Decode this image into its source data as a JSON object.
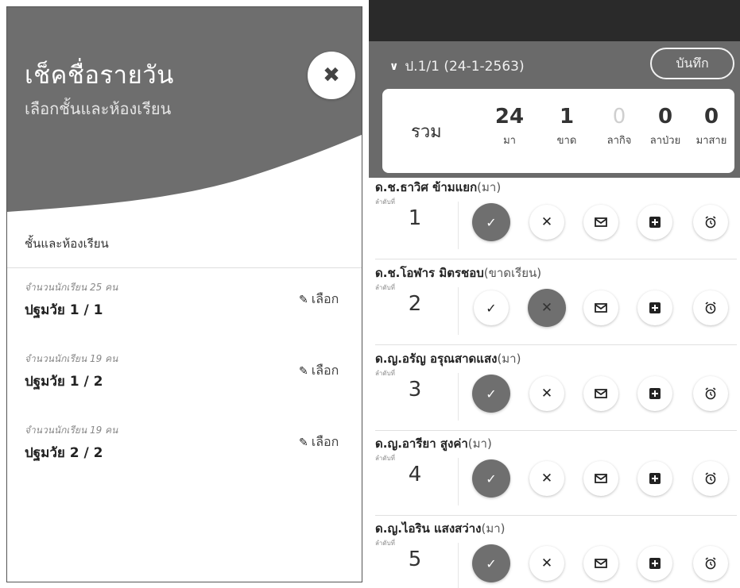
{
  "left_panel": {
    "title": "เช็คชื่อรายวัน",
    "subtitle": "เลือกชั้นและห้องเรียน",
    "close_icon": "✖",
    "section_label": "ชั้นและห้องเรียน",
    "classes": [
      {
        "count": "จำนวนนักเรียน 25 คน",
        "name": "ปฐมวัย 1 / 1",
        "select_label": "เลือก"
      },
      {
        "count": "จำนวนนักเรียน 19 คน",
        "name": "ปฐมวัย 1 / 2",
        "select_label": "เลือก"
      },
      {
        "count": "จำนวนนักเรียน 19 คน",
        "name": "ปฐมวัย 2 / 2",
        "select_label": "เลือก"
      }
    ]
  },
  "right_panel": {
    "class_selector": "ป.1/1 (24-1-2563)",
    "save_label": "บันทึก",
    "summary": {
      "total_label": "รวม",
      "stats": [
        {
          "value": "24",
          "label": "มา"
        },
        {
          "value": "1",
          "label": "ขาด"
        },
        {
          "value": "0",
          "label": "ลากิจ"
        },
        {
          "value": "0",
          "label": "ลาป่วย"
        },
        {
          "value": "0",
          "label": "มาสาย"
        }
      ]
    },
    "seq_label": "ลำดับที่",
    "students": [
      {
        "name": "ด.ช.ธาวิศ ข้ามแยก",
        "status": "(มา)",
        "seq": "1",
        "selected": "present"
      },
      {
        "name": "ด.ช.โอฬาร มิตรชอบ",
        "status": "(ขาดเรียน)",
        "seq": "2",
        "selected": "absent"
      },
      {
        "name": "ด.ญ.อรัญ อรุณสาดแสง",
        "status": "(มา)",
        "seq": "3",
        "selected": "present"
      },
      {
        "name": "ด.ญ.อารียา สูงค่า",
        "status": "(มา)",
        "seq": "4",
        "selected": "present"
      },
      {
        "name": "ด.ญ.ไอริน แสงสว่าง",
        "status": "(มา)",
        "seq": "5",
        "selected": "present"
      }
    ],
    "action_icons": [
      "check-icon",
      "x-icon",
      "mail-icon",
      "plus-square-icon",
      "alarm-icon"
    ]
  },
  "colors": {
    "header_gray": "#6e6e6e",
    "topbar": "#2a2a2a",
    "active_button": "#6f6f6f"
  }
}
